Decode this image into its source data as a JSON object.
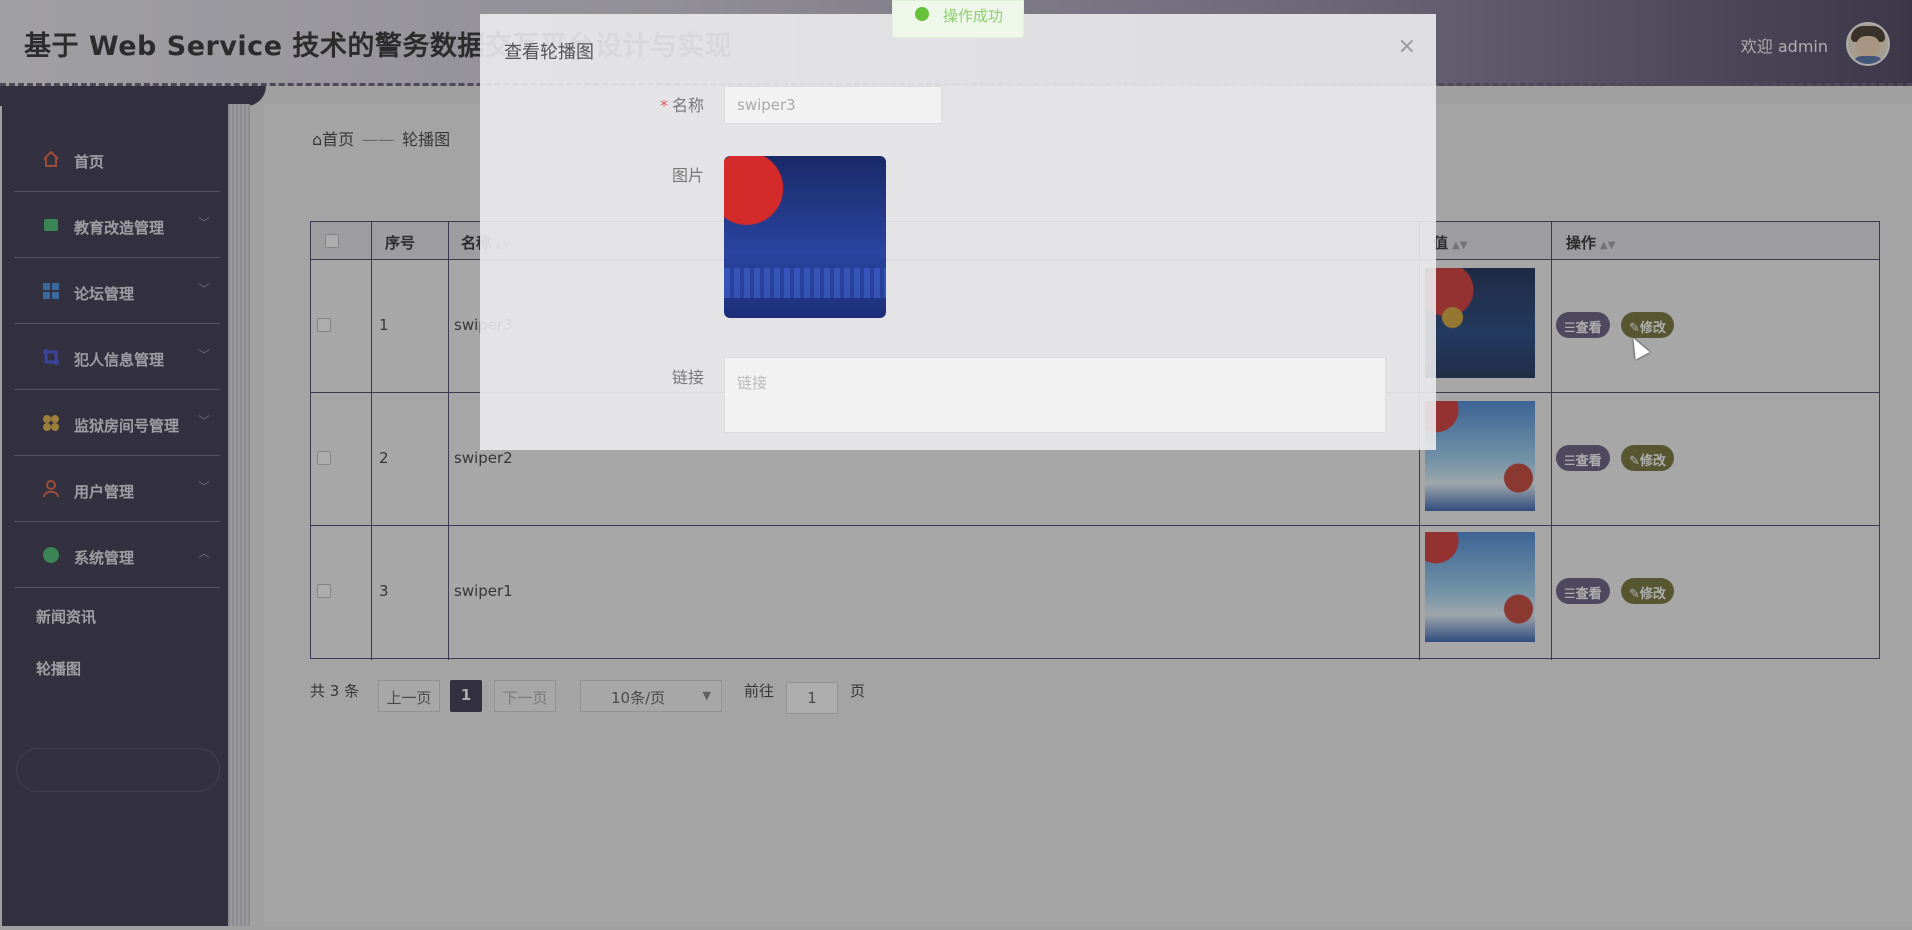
{
  "header": {
    "title": "基于 Web Service 技术的警务数据交互平台设计与实现",
    "welcome": "欢迎 admin"
  },
  "sidebar": {
    "items": [
      {
        "label": "首页",
        "icon": "home-icon",
        "color": "#e05a3a"
      },
      {
        "label": "教育改造管理",
        "icon": "book-icon",
        "color": "#3ab86a"
      },
      {
        "label": "论坛管理",
        "icon": "grid-icon",
        "color": "#3a8ce0"
      },
      {
        "label": "犯人信息管理",
        "icon": "crop-icon",
        "color": "#3a4ae0"
      },
      {
        "label": "监狱房间号管理",
        "icon": "apps-icon",
        "color": "#e0b03a"
      },
      {
        "label": "用户管理",
        "icon": "user-icon",
        "color": "#e05a3a"
      },
      {
        "label": "系统管理",
        "icon": "settings-circle-icon",
        "color": "#3ab86a"
      }
    ],
    "sub_items": [
      "新闻资讯",
      "轮播图"
    ]
  },
  "breadcrumb": {
    "home": "首页",
    "separator": "——",
    "current": "轮播图"
  },
  "table": {
    "headers": {
      "index": "序号",
      "name": "名称",
      "value": "值",
      "actions": "操作"
    },
    "rows": [
      {
        "index": "1",
        "name": "swiper3"
      },
      {
        "index": "2",
        "name": "swiper2"
      },
      {
        "index": "3",
        "name": "swiper1"
      }
    ],
    "view_label": "查看",
    "edit_label": "修改"
  },
  "pagination": {
    "total": "共 3 条",
    "prev": "上一页",
    "current_page": "1",
    "next": "下一页",
    "page_size": "10条/页",
    "goto": "前往",
    "goto_value": "1",
    "page_suffix": "页"
  },
  "dialog": {
    "title": "查看轮播图",
    "close": "×",
    "name_label": "名称",
    "name_value": "swiper3",
    "image_label": "图片",
    "link_label": "链接",
    "link_placeholder": "链接"
  },
  "toast": {
    "text": "操作成功"
  },
  "colors": {
    "sidebar_bg": "#2e2942",
    "primary": "#2e2942",
    "view_button": "#5c5478",
    "edit_button": "#6c6a28",
    "success": "#67c23a"
  }
}
